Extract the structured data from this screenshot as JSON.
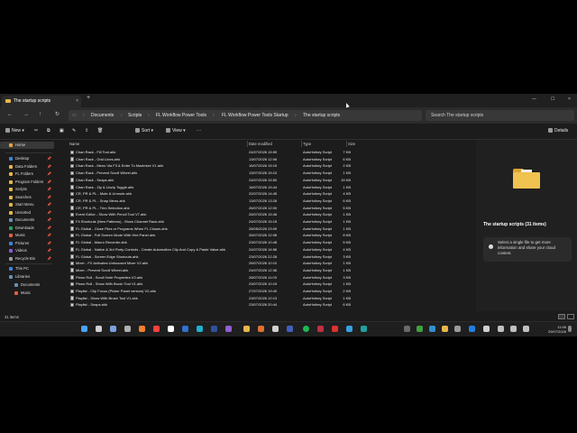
{
  "window": {
    "tab_title": "The startup scripts",
    "close_glyph": "×",
    "new_tab_glyph": "+"
  },
  "breadcrumb": [
    "Documents",
    "Scripts",
    "FL Workflow Power Tools",
    "FL Workflow Power Tools Startup",
    "The startup scripts"
  ],
  "search": {
    "placeholder": "Search The startup scripts"
  },
  "command_bar": {
    "new_label": "New",
    "sort_label": "Sort",
    "view_label": "View",
    "more_label": "···",
    "details_label": "Details"
  },
  "columns": {
    "name": "Name",
    "date": "Date modified",
    "type": "Type",
    "size": "Size"
  },
  "sidebar": {
    "home": "Home",
    "quick_access": [
      {
        "label": "Desktop",
        "color": "#3a86d8"
      },
      {
        "label": "Data Folders",
        "color": "#e8b649"
      },
      {
        "label": "FL Folders",
        "color": "#e8b649"
      },
      {
        "label": "Program Folders",
        "color": "#e8b649"
      },
      {
        "label": "Scripts",
        "color": "#e8b649"
      },
      {
        "label": "Searches",
        "color": "#e8b649"
      },
      {
        "label": "Start Menu",
        "color": "#e8b649"
      },
      {
        "label": "Unsorted",
        "color": "#e8b649"
      },
      {
        "label": "Documents",
        "color": "#6a8fb5"
      },
      {
        "label": "Downloads",
        "color": "#2fa05a"
      },
      {
        "label": "Music",
        "color": "#e06040"
      },
      {
        "label": "Pictures",
        "color": "#3a86d8"
      },
      {
        "label": "Videos",
        "color": "#8a5ad8"
      },
      {
        "label": "Recycle Bin",
        "color": "#9a9a9a"
      }
    ],
    "this_pc": "This PC",
    "libraries": "Libraries",
    "lib_items": [
      "Documents",
      "Music"
    ]
  },
  "files": [
    {
      "name": "Chan Rack - Fill Tool.ahk",
      "date": "24/07/2026 15:59",
      "type": "AutoHotkey Script",
      "size": "7 KB"
    },
    {
      "name": "Chan Rack - Grid Lines.ahk",
      "date": "13/07/2026 12:06",
      "type": "AutoHotkey Script",
      "size": "6 KB"
    },
    {
      "name": "Chan Rack - Menu Via F3 & Enter To Maximize V1.ahk",
      "date": "16/07/2026 15:19",
      "type": "AutoHotkey Script",
      "size": "2 KB"
    },
    {
      "name": "Chan Rack - Prevent Scroll Wheel.ahk",
      "date": "13/07/2026 15:10",
      "type": "AutoHotkey Script",
      "size": "1 KB"
    },
    {
      "name": "Chan Rack - Snaps.ahk",
      "date": "24/07/2026 15:50",
      "type": "AutoHotkey Script",
      "size": "15 KB"
    },
    {
      "name": "Chan Rack - Zip & Unzip Toggle.ahk",
      "date": "16/07/2026 15:44",
      "type": "AutoHotkey Script",
      "size": "1 KB"
    },
    {
      "name": "CR, PR & PL - Mute & Unmute.ahk",
      "date": "22/07/2026 14:45",
      "type": "AutoHotkey Script",
      "size": "4 KB"
    },
    {
      "name": "CR, PR & PL - Snap Menu.ahk",
      "date": "13/07/2026 13:28",
      "type": "AutoHotkey Script",
      "size": "6 KB"
    },
    {
      "name": "CR, PR & PL - Trim Selection.ahk",
      "date": "26/07/2026 12:00",
      "type": "AutoHotkey Script",
      "size": "5 KB"
    },
    {
      "name": "Event Editor - Show With Pencil Tool V7.ahk",
      "date": "26/07/2026 15:46",
      "type": "AutoHotkey Script",
      "size": "1 KB"
    },
    {
      "name": "F4 Shortcuts (New Patterns) - Show Channel Rack.ahk",
      "date": "24/07/2026 15:15",
      "type": "AutoHotkey Script",
      "size": "1 KB"
    },
    {
      "name": "FL Global - Close Files or Programs When FL Closes.ahk",
      "date": "28/05/2026 23:09",
      "type": "AutoHotkey Script",
      "size": "1 KB"
    },
    {
      "name": "FL Global - Full Screen Mode With Hint Panel.ahk",
      "date": "26/07/2026 12:08",
      "type": "AutoHotkey Script",
      "size": "8 KB"
    },
    {
      "name": "FL Global - Macro Recorder.ahk",
      "date": "23/07/2026 10:48",
      "type": "AutoHotkey Script",
      "size": "5 KB"
    },
    {
      "name": "FL Global - Native & 3rd Party Controls - Create Automation Clip And Copy & Paste Value.ahk",
      "date": "24/07/2026 16:56",
      "type": "AutoHotkey Script",
      "size": "4 KB"
    },
    {
      "name": "FL Global - Screen Edge Shortcuts.ahk",
      "date": "23/07/2026 22:28",
      "type": "AutoHotkey Script",
      "size": "3 KB"
    },
    {
      "name": "Mixer - FX Activates Unfocused Mixer V2.ahk",
      "date": "26/07/2026 10:10",
      "type": "AutoHotkey Script",
      "size": "1 KB"
    },
    {
      "name": "Mixer - Prevent Scroll Wheel.ahk",
      "date": "24/07/2026 12:36",
      "type": "AutoHotkey Script",
      "size": "1 KB"
    },
    {
      "name": "Piano Roll - Scroll Note Properties V2.ahk",
      "date": "28/07/2026 11:03",
      "type": "AutoHotkey Script",
      "size": "3 KB"
    },
    {
      "name": "Piano Roll - Show With Brush Tool V1.ahk",
      "date": "23/07/2026 10:15",
      "type": "AutoHotkey Script",
      "size": "1 KB"
    },
    {
      "name": "Playlist - Clip Focus (Picker Panel version) V2.ahk",
      "date": "27/07/2026 19:40",
      "type": "AutoHotkey Script",
      "size": "2 KB"
    },
    {
      "name": "Playlist - Show With Brush Tool V1.ahk",
      "date": "23/07/2026 10:13",
      "type": "AutoHotkey Script",
      "size": "1 KB"
    },
    {
      "name": "Playlist - Snaps.ahk",
      "date": "23/07/2026 20:44",
      "type": "AutoHotkey Script",
      "size": "6 KB"
    }
  ],
  "details_pane": {
    "title": "The startup scripts (31 items)",
    "info": "Select a single file to get more information and share your cloud content."
  },
  "status": {
    "count": "31 items"
  },
  "tray": {
    "time": "11:56",
    "date": "29/07/2026"
  }
}
